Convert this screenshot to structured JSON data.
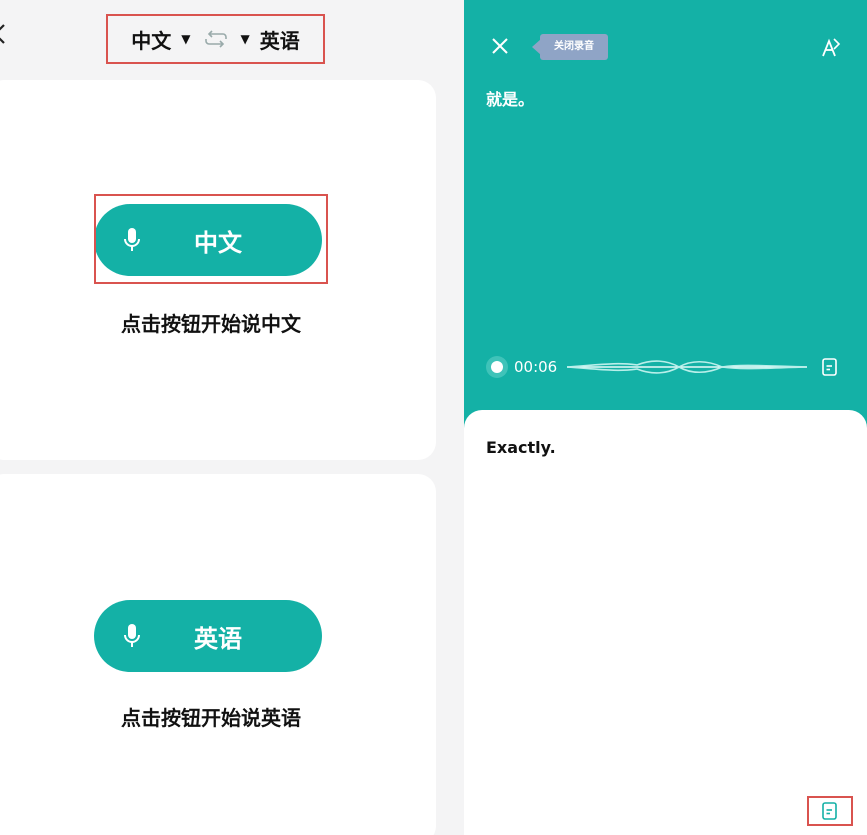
{
  "left": {
    "source_lang": "中文",
    "target_lang": "英语",
    "cards": [
      {
        "button_label": "中文",
        "hint": "点击按钮开始说中文"
      },
      {
        "button_label": "英语",
        "hint": "点击按钮开始说英语"
      }
    ]
  },
  "right": {
    "tooltip": "关闭录音",
    "source_text": "就是。",
    "time": "00:06",
    "result_text": "Exactly."
  },
  "colors": {
    "accent": "#14b1a6",
    "highlight": "#d9534f",
    "tooltip_bg": "#8fa4c6"
  }
}
